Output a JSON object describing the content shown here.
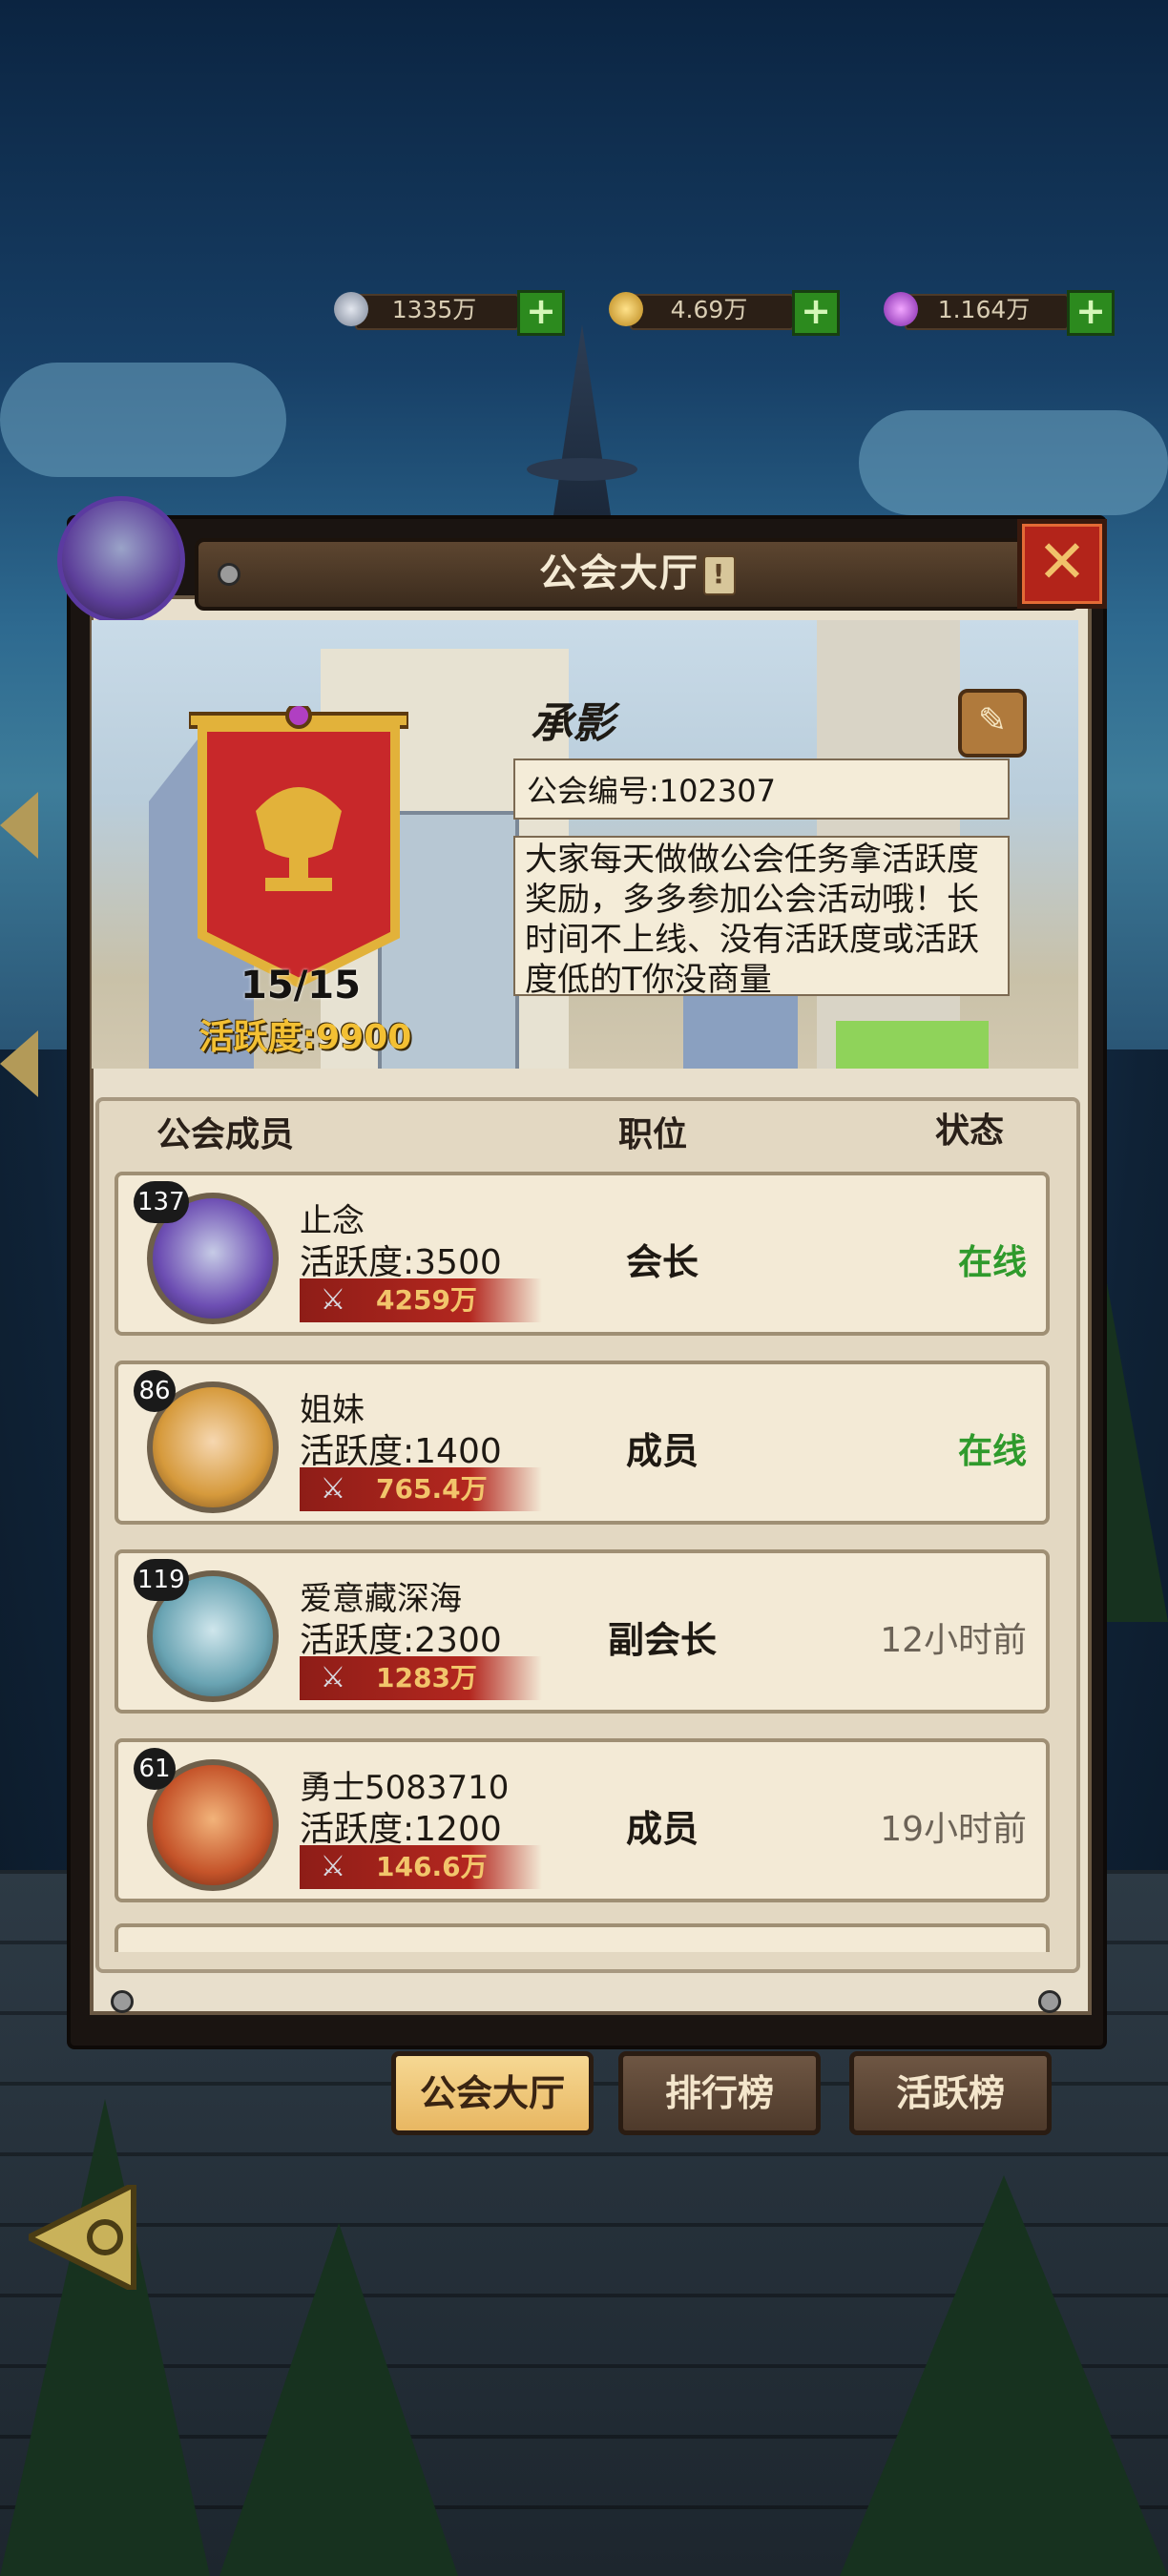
{
  "currencies": [
    {
      "icon": "silver-coin-icon",
      "value": "1335万"
    },
    {
      "icon": "gold-coin-icon",
      "value": "4.69万"
    },
    {
      "icon": "purple-gem-icon",
      "value": "1.164万"
    }
  ],
  "panel": {
    "title": "公会大厅",
    "info_mark": "!",
    "close_icon": "close-icon"
  },
  "guild": {
    "name": "承影",
    "id_text": "公会编号:102307",
    "notice": "大家每天做做公会任务拿活跃度奖励，多多参加公会活动哦！长时间不上线、没有活跃度或活跃度低的T你没商量",
    "member_count": "15/15",
    "activity": "活跃度:9900"
  },
  "list_headers": {
    "members": "公会成员",
    "position": "职位",
    "status": "状态"
  },
  "members": [
    {
      "level": "137",
      "name": "止念",
      "activity": "活跃度:3500",
      "power": "4259万",
      "position": "会长",
      "status": "在线",
      "online": true
    },
    {
      "level": "86",
      "name": "姐妹",
      "activity": "活跃度:1400",
      "power": "765.4万",
      "position": "成员",
      "status": "在线",
      "online": true
    },
    {
      "level": "119",
      "name": "爱意藏深海",
      "activity": "活跃度:2300",
      "power": "1283万",
      "position": "副会长",
      "status": "12小时前",
      "online": false
    },
    {
      "level": "61",
      "name": "勇士5083710",
      "activity": "活跃度:1200",
      "power": "146.6万",
      "position": "成员",
      "status": "19小时前",
      "online": false
    }
  ],
  "tabs": [
    "公会大厅",
    "排行榜",
    "活跃榜"
  ],
  "colors": {
    "online": "#2f9a2c",
    "accent_gold": "#f3c033",
    "banner_red": "#c8282a"
  }
}
